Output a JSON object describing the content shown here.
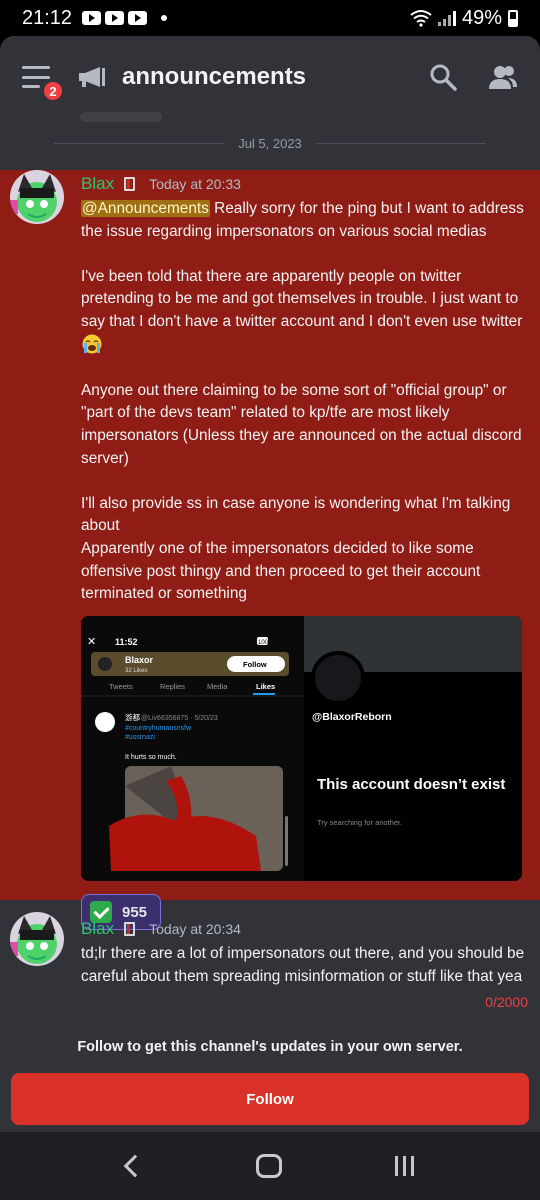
{
  "status": {
    "time": "21:12",
    "battery": "49%"
  },
  "header": {
    "channel": "announcements",
    "badge_count": "2",
    "icons": [
      "menu-icon",
      "megaphone-icon",
      "search-icon",
      "members-icon"
    ]
  },
  "date_separator": "Jul 5, 2023",
  "messages": [
    {
      "author": "Blax",
      "timestamp": "Today at 20:33",
      "mention": "@Announcements",
      "lines": [
        " Really sorry for the ping but I want to address the issue regarding impersonators on various social medias",
        "I've been told that there are apparently people on twitter pretending to be me and got themselves in trouble. I just want to say that I don't have a twitter account and I don't even use twitter",
        "Anyone out there claiming to be some sort of \"official group\" or \"part of the devs team\" related to kp/tfe are most likely impersonators (Unless they are announced on the actual discord server)",
        "I'll also provide ss in case anyone is wondering what I'm talking about",
        "Apparently one of the impersonators decided to like some offensive post thingy and then proceed to get their account terminated or something"
      ],
      "attachment": {
        "left": {
          "time": "11:52",
          "profile_name": "Blaxor",
          "likes_count": "32 Likes",
          "follow_label": "Follow",
          "tabs": [
            "Tweets",
            "Replies",
            "Media",
            "Likes"
          ],
          "tweet_handle": "@Liv66356875 · 5/20/23",
          "tweet_name": "游都",
          "tweet_tags": [
            "#countryhumansnsfw",
            "#ussrnazi"
          ],
          "tweet_text": "It hurts so much.",
          "battery_badge": "100"
        },
        "right": {
          "handle": "@BlaxorReborn",
          "heading": "This account doesn’t exist",
          "subtext": "Try searching for another."
        }
      },
      "reaction": {
        "emoji": "check-icon",
        "count": "955"
      }
    },
    {
      "author": "Blax",
      "timestamp": "Today at 20:34",
      "text": "td;lr there are a lot of impersonators out there, and you should be careful about them spreading misinformation or stuff like that yea"
    }
  ],
  "char_counter": "0/2000",
  "follow_prompt": "Follow to get this channel's updates in your own server.",
  "follow_button": "Follow",
  "colors": {
    "highlight": "#8f1d16",
    "username": "#2dc770",
    "follow": "#da3228",
    "background": "#313338"
  }
}
